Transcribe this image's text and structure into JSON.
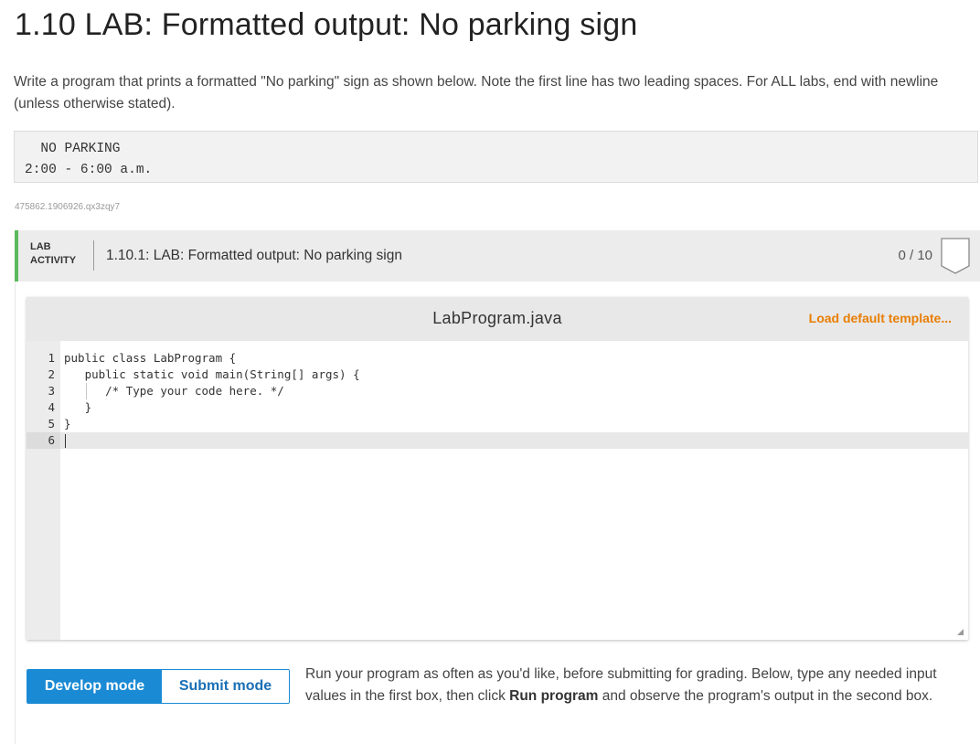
{
  "title": "1.10 LAB: Formatted output: No parking sign",
  "instructions": "Write a program that prints a formatted \"No parking\" sign as shown below. Note the first line has two leading spaces. For ALL labs, end with newline (unless otherwise stated).",
  "sample_output": {
    "line1": "  NO PARKING",
    "line2": "2:00 - 6:00 a.m."
  },
  "activity_id": "475862.1906926.qx3zqy7",
  "lab_activity": {
    "label_line1": "LAB",
    "label_line2": "ACTIVITY",
    "name": "1.10.1: LAB: Formatted output: No parking sign",
    "score": "0 / 10",
    "badge_icon": "badge-shield-icon"
  },
  "editor": {
    "filename": "LabProgram.java",
    "load_default": "Load default template...",
    "line_numbers": [
      "1",
      "2",
      "3",
      "4",
      "5",
      "6"
    ],
    "code_lines": [
      "public class LabProgram {",
      "   public static void main(String[] args) {",
      "      /* Type your code here. */",
      "   }",
      "}",
      ""
    ]
  },
  "modes": {
    "develop": "Develop mode",
    "submit": "Submit mode"
  },
  "run_description": {
    "before": "Run your program as often as you'd like, before submitting for grading. Below, type any needed input values in the first box, then click ",
    "bold": "Run program",
    "after": " and observe the program's output in the second box."
  },
  "colors": {
    "accent_blue": "#1a8ad4",
    "accent_orange": "#e87e04",
    "lab_green": "#5cb85c"
  }
}
